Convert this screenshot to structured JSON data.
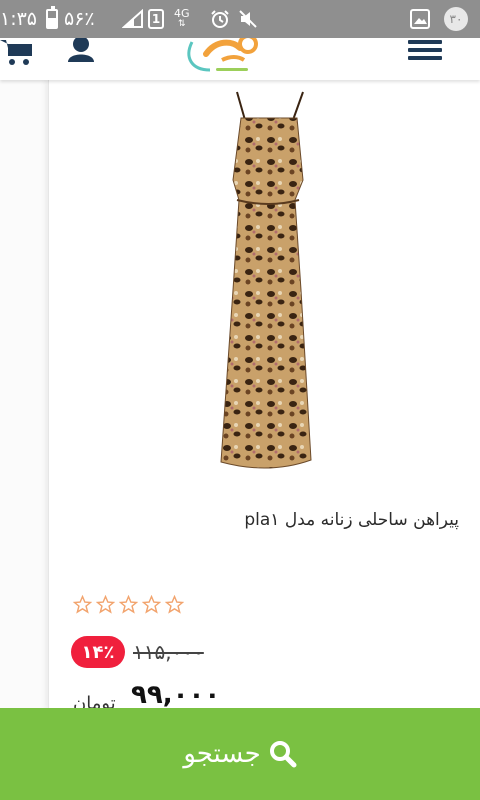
{
  "status_bar": {
    "time": "۱:۳۵",
    "battery_percent": "۵۶٪",
    "battery_level": 0.56,
    "sim_label": "1",
    "network_label": "4G",
    "notification_badge": "۳۰"
  },
  "header": {
    "menu_icon": "hamburger-menu-icon",
    "user_icon": "user-icon",
    "cart_icon": "cart-icon"
  },
  "product": {
    "title": "پیراهن ساحلی زنانه مدل pla۱",
    "rating_stars": 0,
    "rating_max": 5,
    "discount": "۱۴٪",
    "old_price": "۱۱۵,۰۰۰",
    "price": "۹۹,۰۰۰",
    "currency": "تومان"
  },
  "search_bar": {
    "label": "جستجو",
    "icon": "search-icon"
  },
  "colors": {
    "accent_green": "#7ac142",
    "discount_red": "#f0203d",
    "star_outline": "#f2a46e",
    "header_icon": "#1f3a57"
  }
}
